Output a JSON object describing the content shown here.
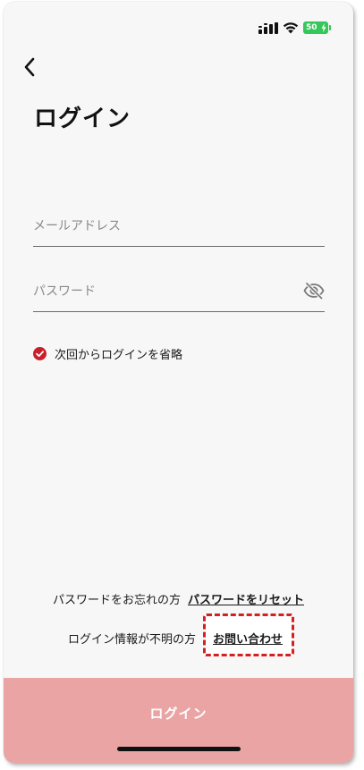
{
  "status_bar": {
    "battery_level": "50",
    "battery_color": "#35c759"
  },
  "header": {
    "back_icon": "chevron-left-icon",
    "title": "ログイン"
  },
  "form": {
    "email": {
      "placeholder": "メールアドレス",
      "value": ""
    },
    "password": {
      "placeholder": "パスワード",
      "value": "",
      "visibility_icon": "eye-off-icon"
    },
    "remember": {
      "label": "次回からログインを省略",
      "checked": true,
      "icon": "check-circle-icon",
      "color": "#c8202a"
    }
  },
  "footer": {
    "forgot_text": "パスワードをお忘れの方",
    "reset_link": "パスワードをリセット",
    "unknown_text": "ログイン情報が不明の方",
    "contact_link": "お問い合わせ",
    "highlight_color": "#d42020"
  },
  "login_button": {
    "label": "ログイン",
    "background": "#eba4a4"
  }
}
